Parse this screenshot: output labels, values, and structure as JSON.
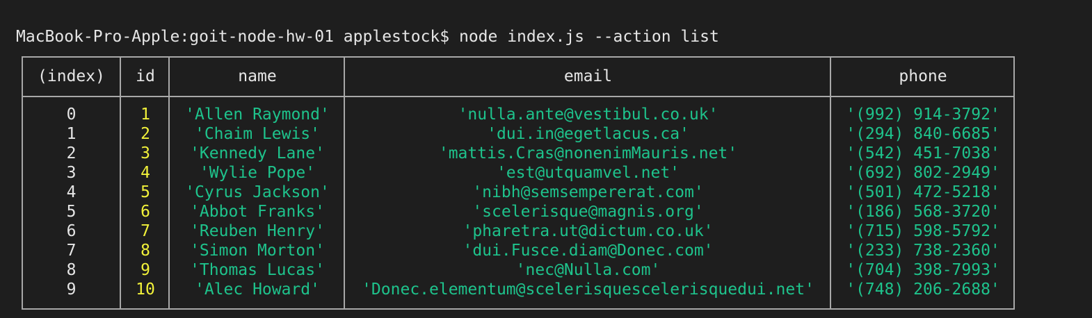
{
  "terminal": {
    "prompt": "MacBook-Pro-Apple:goit-node-hw-01 applestock$ node index.js --action list"
  },
  "table": {
    "headers": {
      "index": "(index)",
      "id": "id",
      "name": "name",
      "email": "email",
      "phone": "phone"
    },
    "rows": [
      {
        "index": "0",
        "id": "1",
        "name": "'Allen Raymond'",
        "email": "'nulla.ante@vestibul.co.uk'",
        "phone": "'(992) 914-3792'"
      },
      {
        "index": "1",
        "id": "2",
        "name": "'Chaim Lewis'",
        "email": "'dui.in@egetlacus.ca'",
        "phone": "'(294) 840-6685'"
      },
      {
        "index": "2",
        "id": "3",
        "name": "'Kennedy Lane'",
        "email": "'mattis.Cras@nonenimMauris.net'",
        "phone": "'(542) 451-7038'"
      },
      {
        "index": "3",
        "id": "4",
        "name": "'Wylie Pope'",
        "email": "'est@utquamvel.net'",
        "phone": "'(692) 802-2949'"
      },
      {
        "index": "4",
        "id": "5",
        "name": "'Cyrus Jackson'",
        "email": "'nibh@semsempererat.com'",
        "phone": "'(501) 472-5218'"
      },
      {
        "index": "5",
        "id": "6",
        "name": "'Abbot Franks'",
        "email": "'scelerisque@magnis.org'",
        "phone": "'(186) 568-3720'"
      },
      {
        "index": "6",
        "id": "7",
        "name": "'Reuben Henry'",
        "email": "'pharetra.ut@dictum.co.uk'",
        "phone": "'(715) 598-5792'"
      },
      {
        "index": "7",
        "id": "8",
        "name": "'Simon Morton'",
        "email": "'dui.Fusce.diam@Donec.com'",
        "phone": "'(233) 738-2360'"
      },
      {
        "index": "8",
        "id": "9",
        "name": "'Thomas Lucas'",
        "email": "'nec@Nulla.com'",
        "phone": "'(704) 398-7993'"
      },
      {
        "index": "9",
        "id": "10",
        "name": "'Alec Howard'",
        "email": "'Donec.elementum@scelerisquescelerisquedui.net'",
        "phone": "'(748) 206-2688'"
      }
    ]
  },
  "colors": {
    "background": "#1e1e1e",
    "text": "#e6e6e6",
    "number": "#f2f23a",
    "string": "#1ec38c",
    "border": "#a8a8a8"
  }
}
